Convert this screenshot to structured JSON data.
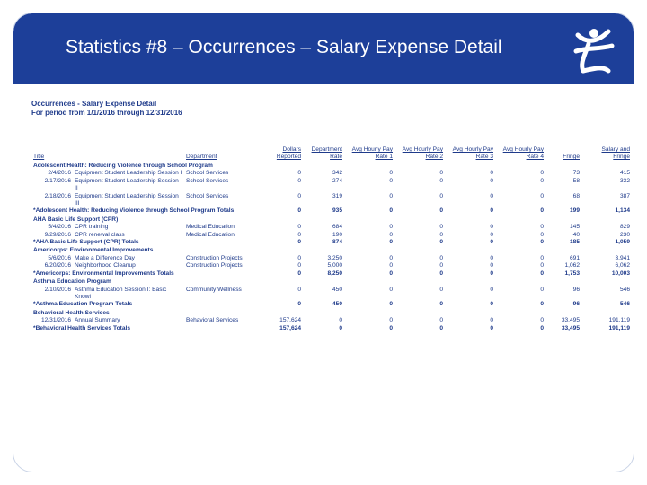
{
  "slide": {
    "title": "Statistics #8 – Occurrences – Salary Expense Detail"
  },
  "report": {
    "title": "Occurrences - Salary Expense Detail",
    "period": "For period from 1/1/2016 through 12/31/2016",
    "columns": [
      "Title",
      "Department",
      "Dollars Reported",
      "Department Rate",
      "Avg Hourly Pay Rate 1",
      "Avg Hourly Pay Rate 2",
      "Avg Hourly Pay Rate 3",
      "Avg Hourly Pay Rate 4",
      "Fringe",
      "Salary and Fringe"
    ],
    "rows": [
      {
        "type": "group",
        "label": "Adolescent Health: Reducing Violence through School Program"
      },
      {
        "type": "detail",
        "date": "2/4/2016",
        "title": "Equipment Student Leadership Session I",
        "dept": "School Services",
        "dollars": "0",
        "rate": "342",
        "p1": "0",
        "p2": "0",
        "p3": "0",
        "p4": "0",
        "fringe": "73",
        "total": "415"
      },
      {
        "type": "detail",
        "date": "2/17/2016",
        "title": "Equipment Student Leadership Session II",
        "dept": "School Services",
        "dollars": "0",
        "rate": "274",
        "p1": "0",
        "p2": "0",
        "p3": "0",
        "p4": "0",
        "fringe": "58",
        "total": "332"
      },
      {
        "type": "detail",
        "date": "2/18/2016",
        "title": "Equipment Student Leadership Session III",
        "dept": "School Services",
        "dollars": "0",
        "rate": "319",
        "p1": "0",
        "p2": "0",
        "p3": "0",
        "p4": "0",
        "fringe": "68",
        "total": "387"
      },
      {
        "type": "total",
        "label": "*Adolescent Health: Reducing Violence through School Program Totals",
        "dollars": "0",
        "rate": "935",
        "p1": "0",
        "p2": "0",
        "p3": "0",
        "p4": "0",
        "fringe": "199",
        "total": "1,134"
      },
      {
        "type": "group",
        "label": "AHA Basic Life Support (CPR)"
      },
      {
        "type": "detail",
        "date": "5/4/2016",
        "title": "CPR training",
        "dept": "Medical Education",
        "dollars": "0",
        "rate": "684",
        "p1": "0",
        "p2": "0",
        "p3": "0",
        "p4": "0",
        "fringe": "145",
        "total": "829"
      },
      {
        "type": "detail",
        "date": "9/29/2016",
        "title": "CPR renewal class",
        "dept": "Medical Education",
        "dollars": "0",
        "rate": "190",
        "p1": "0",
        "p2": "0",
        "p3": "0",
        "p4": "0",
        "fringe": "40",
        "total": "230"
      },
      {
        "type": "total",
        "label": "*AHA Basic Life Support (CPR) Totals",
        "dollars": "0",
        "rate": "874",
        "p1": "0",
        "p2": "0",
        "p3": "0",
        "p4": "0",
        "fringe": "185",
        "total": "1,059"
      },
      {
        "type": "group",
        "label": "Americorps: Environmental Improvements"
      },
      {
        "type": "detail",
        "date": "5/6/2016",
        "title": "Make a Difference Day",
        "dept": "Construction Projects",
        "dollars": "0",
        "rate": "3,250",
        "p1": "0",
        "p2": "0",
        "p3": "0",
        "p4": "0",
        "fringe": "691",
        "total": "3,941"
      },
      {
        "type": "detail",
        "date": "6/20/2016",
        "title": "Neighborhood Cleanup",
        "dept": "Construction Projects",
        "dollars": "0",
        "rate": "5,000",
        "p1": "0",
        "p2": "0",
        "p3": "0",
        "p4": "0",
        "fringe": "1,062",
        "total": "6,062"
      },
      {
        "type": "total",
        "label": "*Americorps: Environmental Improvements Totals",
        "dollars": "0",
        "rate": "8,250",
        "p1": "0",
        "p2": "0",
        "p3": "0",
        "p4": "0",
        "fringe": "1,753",
        "total": "10,003"
      },
      {
        "type": "group",
        "label": "Asthma Education Program"
      },
      {
        "type": "detail",
        "date": "2/10/2016",
        "title": "Asthma Education Session I: Basic Knowl",
        "dept": "Community Wellness",
        "dollars": "0",
        "rate": "450",
        "p1": "0",
        "p2": "0",
        "p3": "0",
        "p4": "0",
        "fringe": "96",
        "total": "546"
      },
      {
        "type": "total",
        "label": "*Asthma Education Program Totals",
        "dollars": "0",
        "rate": "450",
        "p1": "0",
        "p2": "0",
        "p3": "0",
        "p4": "0",
        "fringe": "96",
        "total": "546"
      },
      {
        "type": "group",
        "label": "Behavioral Health Services"
      },
      {
        "type": "detail",
        "date": "12/31/2016",
        "title": "Annual Summary",
        "dept": "Behavioral Services",
        "dollars": "157,624",
        "rate": "0",
        "p1": "0",
        "p2": "0",
        "p3": "0",
        "p4": "0",
        "fringe": "33,495",
        "total": "191,119"
      },
      {
        "type": "total",
        "label": "*Behavioral Health Services Totals",
        "dollars": "157,624",
        "rate": "0",
        "p1": "0",
        "p2": "0",
        "p3": "0",
        "p4": "0",
        "fringe": "33,495",
        "total": "191,119"
      }
    ]
  },
  "colors": {
    "title_bar": "#1d3f99",
    "text": "#1e3a8a",
    "frame": "#c9d3e6"
  },
  "icons": {
    "logo": "figure-logo-icon"
  }
}
